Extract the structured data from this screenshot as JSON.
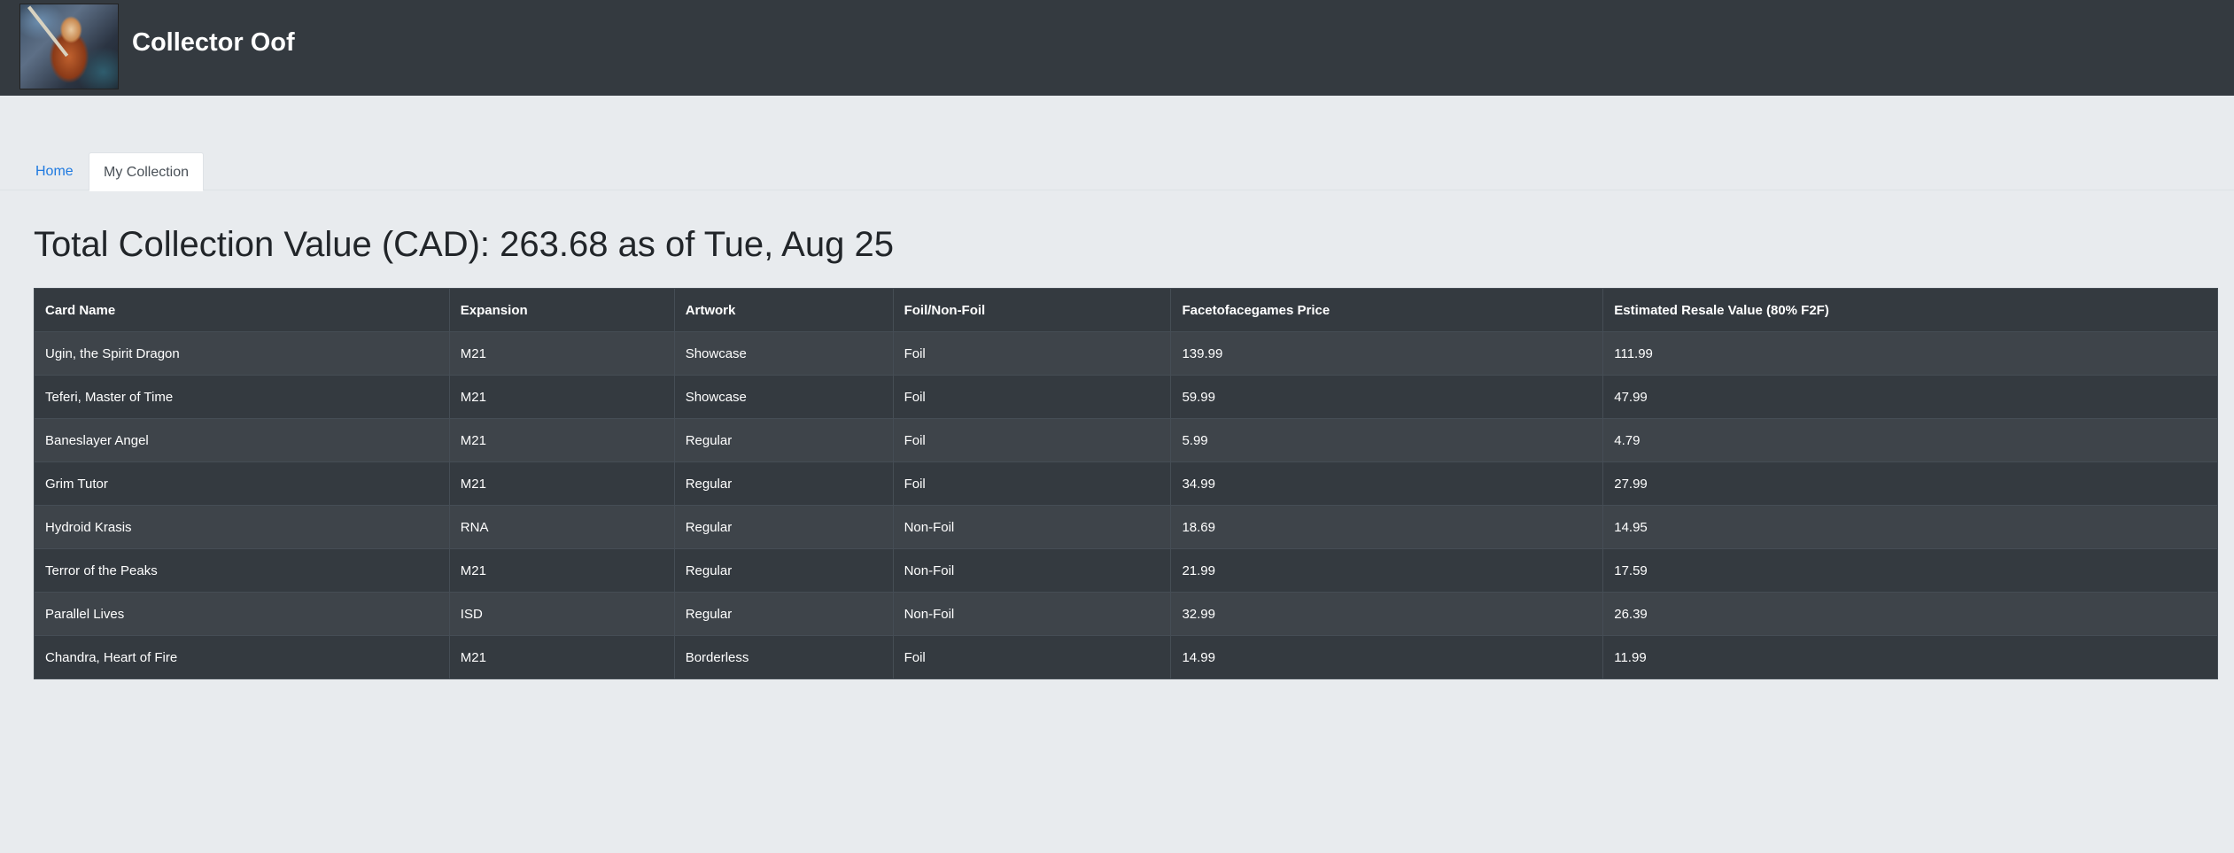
{
  "header": {
    "brand_title": "Collector Oof",
    "logo_icon": "card-art-logo-icon"
  },
  "tabs": [
    {
      "label": "Home",
      "active": false
    },
    {
      "label": "My Collection",
      "active": true
    }
  ],
  "page": {
    "title": "Total Collection Value (CAD): 263.68 as of Tue, Aug 25"
  },
  "table": {
    "columns": [
      "Card Name",
      "Expansion",
      "Artwork",
      "Foil/Non-Foil",
      "Facetofacegames Price",
      "Estimated Resale Value (80% F2F)"
    ],
    "rows": [
      [
        "Ugin, the Spirit Dragon",
        "M21",
        "Showcase",
        "Foil",
        "139.99",
        "111.99"
      ],
      [
        "Teferi, Master of Time",
        "M21",
        "Showcase",
        "Foil",
        "59.99",
        "47.99"
      ],
      [
        "Baneslayer Angel",
        "M21",
        "Regular",
        "Foil",
        "5.99",
        "4.79"
      ],
      [
        "Grim Tutor",
        "M21",
        "Regular",
        "Foil",
        "34.99",
        "27.99"
      ],
      [
        "Hydroid Krasis",
        "RNA",
        "Regular",
        "Non-Foil",
        "18.69",
        "14.95"
      ],
      [
        "Terror of the Peaks",
        "M21",
        "Regular",
        "Non-Foil",
        "21.99",
        "17.59"
      ],
      [
        "Parallel Lives",
        "ISD",
        "Regular",
        "Non-Foil",
        "32.99",
        "26.39"
      ],
      [
        "Chandra, Heart of Fire",
        "M21",
        "Borderless",
        "Foil",
        "14.99",
        "11.99"
      ]
    ]
  },
  "colors": {
    "navbar": "#343a40",
    "page_background": "#e8ebee",
    "link": "#1f7ae0",
    "table_row_odd": "#3e444a",
    "table_row_even": "#343a40"
  }
}
